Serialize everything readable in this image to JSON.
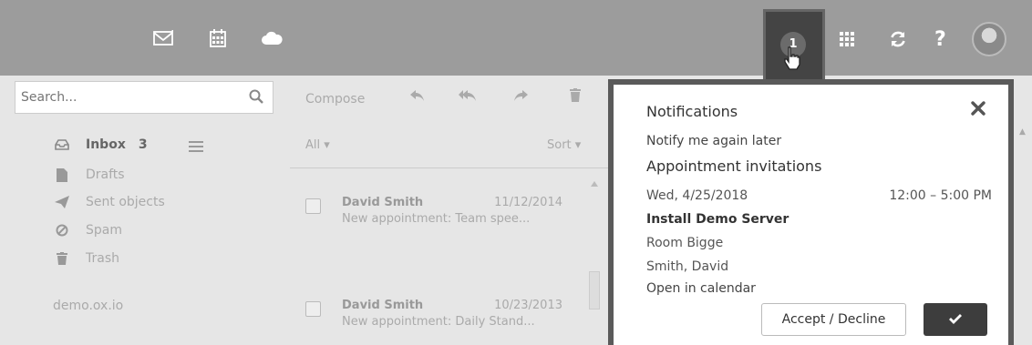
{
  "header": {
    "badge_count": "1"
  },
  "sidebar": {
    "search": {
      "placeholder": "Search..."
    },
    "folders": [
      {
        "label": "Inbox",
        "count": "3"
      },
      {
        "label": "Drafts"
      },
      {
        "label": "Sent objects"
      },
      {
        "label": "Spam"
      },
      {
        "label": "Trash"
      }
    ],
    "account": "demo.ox.io"
  },
  "list": {
    "compose_label": "Compose",
    "filter_label": "All",
    "sort_label": "Sort",
    "items": [
      {
        "from": "David Smith",
        "date": "11/12/2014",
        "subject": "New appointment: Team spee..."
      },
      {
        "from": "David Smith",
        "date": "10/23/2013",
        "subject": "New appointment: Daily Stand..."
      }
    ]
  },
  "notifications": {
    "title": "Notifications",
    "notify_later": "Notify me again later",
    "section_title": "Appointment invitations",
    "appointment": {
      "date": "Wed, 4/25/2018",
      "time": "12:00 – 5:00 PM",
      "title": "Install Demo Server",
      "location": "Room Bigge",
      "organizer": "Smith, David",
      "open_link": "Open in calendar"
    },
    "accept_label": "Accept / Decline"
  },
  "colors": {
    "topbar": "#9c9c9c",
    "popup_border": "#5a5a5a",
    "ok_button": "#3d3d3d"
  }
}
